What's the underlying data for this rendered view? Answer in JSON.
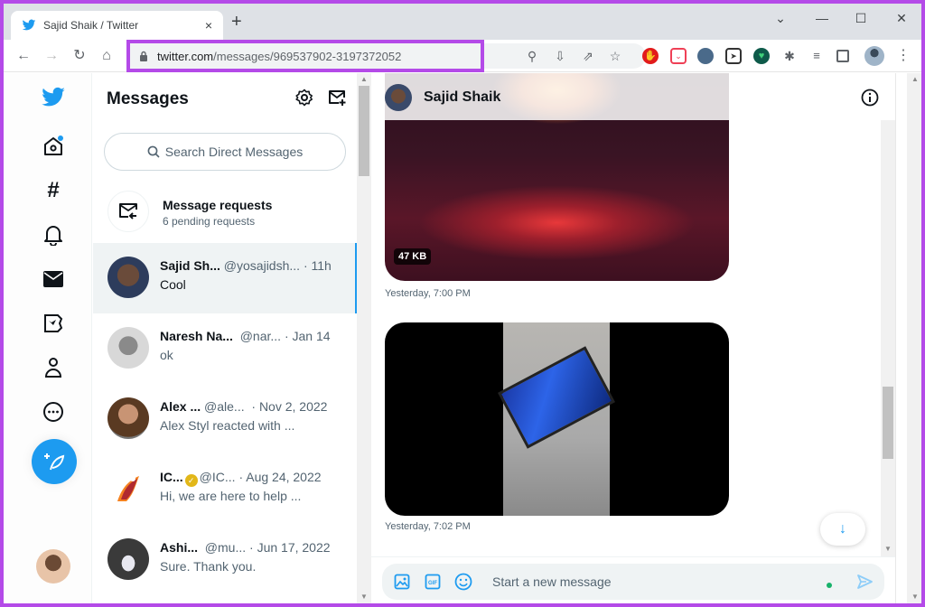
{
  "browser": {
    "tab_title": "Sajid Shaik / Twitter",
    "tab_close": "×",
    "new_tab": "+",
    "url_host": "twitter.com",
    "url_path": "/messages/969537902-3197372052",
    "window_controls": {
      "dropdown": "⌄",
      "minimize": "—",
      "maximize": "☐",
      "close": "✕"
    },
    "nav": {
      "back": "←",
      "forward": "→",
      "reload": "↻",
      "home": "⌂"
    },
    "omnibox_icons": [
      "search-icon",
      "install-icon",
      "share-icon",
      "bookmark-star-icon"
    ],
    "extensions": [
      "adblock-icon",
      "pocket-icon",
      "ghostery-icon",
      "telegram-icon",
      "grammar-icon",
      "extensions-puzzle-icon",
      "media-queue-icon",
      "side-panel-icon",
      "profile-avatar",
      "menu-icon"
    ]
  },
  "left_nav": {
    "items": [
      "twitter-logo",
      "home",
      "explore",
      "notifications",
      "messages",
      "twitter-blue",
      "profile",
      "more"
    ],
    "home_badge": true,
    "compose_label": "Tweet"
  },
  "messages": {
    "title": "Messages",
    "search_placeholder": "Search Direct Messages",
    "requests": {
      "title": "Message requests",
      "subtitle": "6 pending requests"
    },
    "conversations": [
      {
        "name": "Sajid Sh...",
        "handle": "@yosajidsh...",
        "time": "· 11h",
        "preview": "Cool",
        "active": true,
        "verified": false
      },
      {
        "name": "Naresh Na...",
        "handle": "@nar...",
        "time": "· Jan 14",
        "preview": "ok",
        "active": false,
        "verified": false
      },
      {
        "name": "Alex ...",
        "handle": "@ale...",
        "time": "· Nov 2, 2022",
        "preview": "Alex Styl reacted with ...",
        "active": false,
        "verified": false
      },
      {
        "name": "IC...",
        "handle": "@IC...",
        "time": "· Aug 24, 2022",
        "preview": "Hi, we are here to help ...",
        "active": false,
        "verified": true
      },
      {
        "name": "Ashi...",
        "handle": "@mu...",
        "time": "· Jun 17, 2022",
        "preview": "Sure. Thank you.",
        "active": false,
        "verified": false
      }
    ]
  },
  "conversation": {
    "contact_name": "Sajid Shaik",
    "messages": [
      {
        "type": "image",
        "size_badge": "47 KB",
        "timestamp": "Yesterday, 7:00 PM"
      },
      {
        "type": "video",
        "timestamp": "Yesterday, 7:02 PM"
      }
    ],
    "composer_placeholder": "Start a new message",
    "scroll_down": "↓"
  },
  "colors": {
    "accent": "#1d9bf0",
    "highlight": "#b44ae8"
  }
}
